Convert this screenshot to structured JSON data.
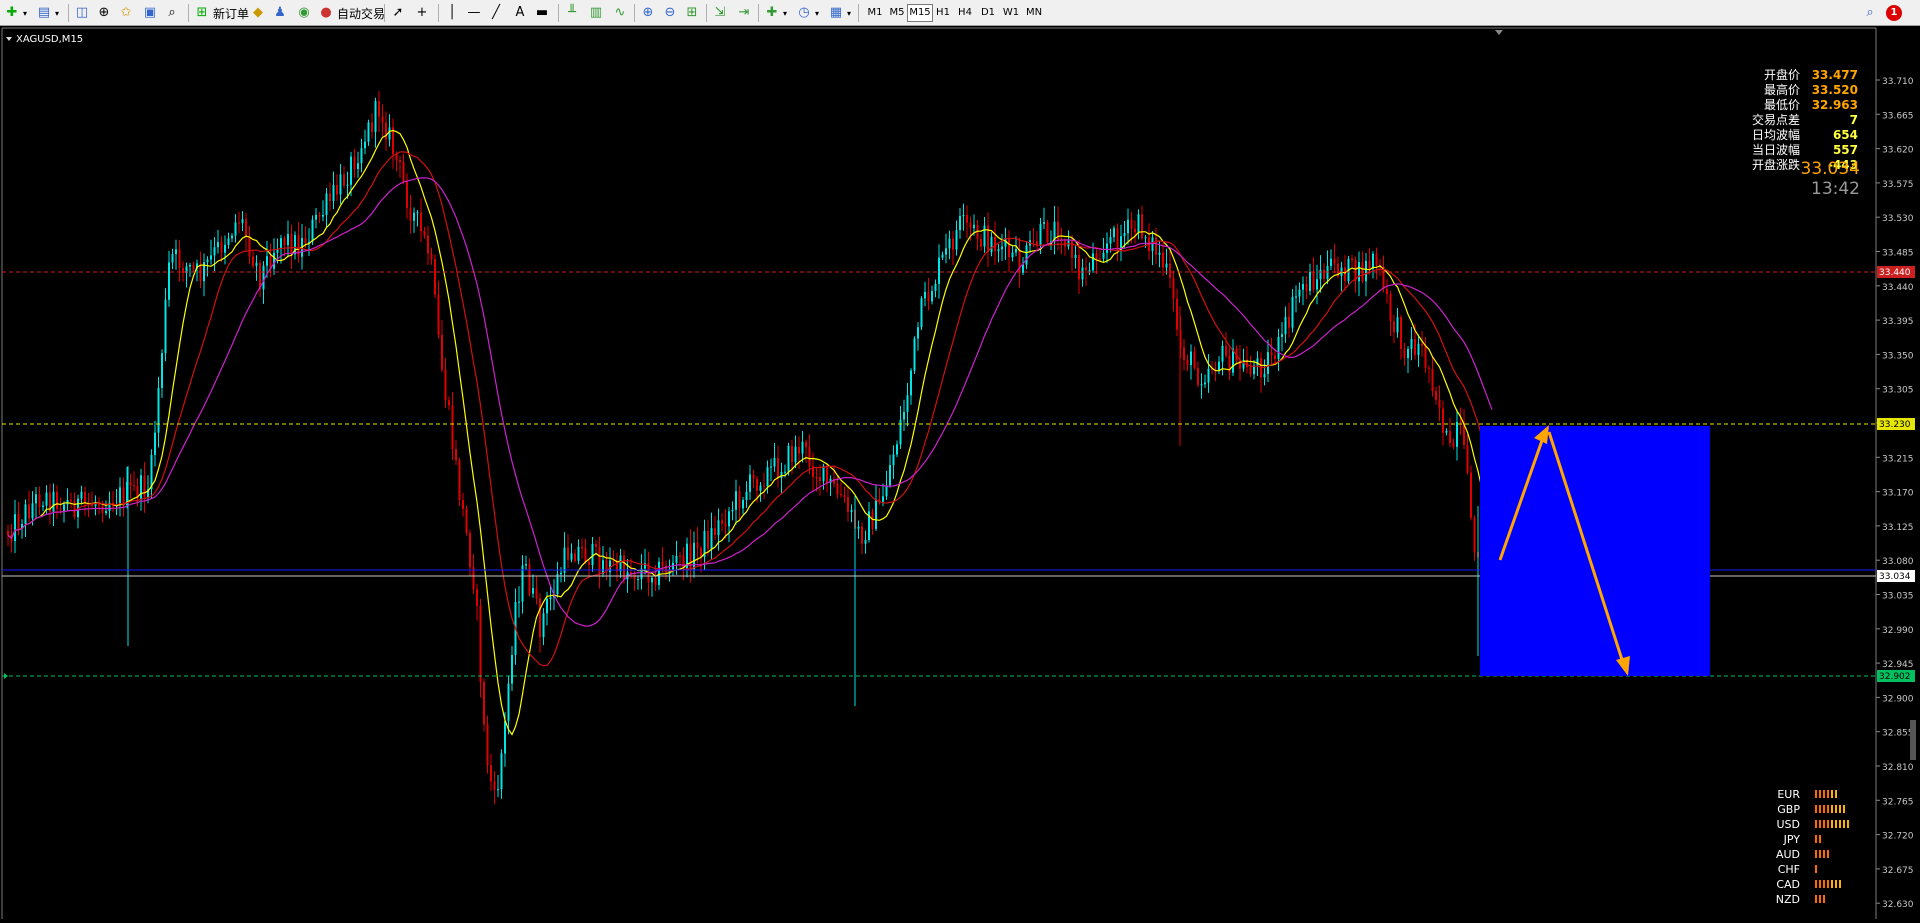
{
  "toolbar": {
    "new_order_label": "新订单",
    "auto_trade_label": "自动交易",
    "timeframes": [
      "M1",
      "M5",
      "M15",
      "H1",
      "H4",
      "D1",
      "W1",
      "MN"
    ],
    "active_timeframe": "M15",
    "notification_count": "1"
  },
  "chart": {
    "symbol_label": "XAGUSD,M15",
    "current_price": "33.034",
    "countdown": "13:42",
    "info_panel": [
      {
        "label": "开盘价",
        "value": "33.477"
      },
      {
        "label": "最高价",
        "value": "33.520"
      },
      {
        "label": "最低价",
        "value": "32.963"
      },
      {
        "label": "交易点差",
        "value": "7"
      },
      {
        "label": "日均波幅",
        "value": "654"
      },
      {
        "label": "当日波幅",
        "value": "557"
      },
      {
        "label": "开盘涨跌",
        "value": "-443"
      }
    ],
    "currency_strength": [
      {
        "label": "EUR",
        "level": 6
      },
      {
        "label": "GBP",
        "level": 8
      },
      {
        "label": "USD",
        "level": 9
      },
      {
        "label": "JPY",
        "level": 2
      },
      {
        "label": "AUD",
        "level": 4
      },
      {
        "label": "CHF",
        "level": 1
      },
      {
        "label": "CAD",
        "level": 7
      },
      {
        "label": "NZD",
        "level": 3
      }
    ],
    "price_axis": [
      "33.710",
      "33.665",
      "33.620",
      "33.575",
      "33.530",
      "33.485",
      "33.440",
      "33.395",
      "33.350",
      "33.305",
      "33.260",
      "33.215",
      "33.170",
      "33.125",
      "33.080",
      "33.035",
      "32.990",
      "32.945",
      "32.900",
      "32.855",
      "32.810",
      "32.765",
      "32.720",
      "32.675",
      "32.630"
    ],
    "level_labels": {
      "red_level": "33.440",
      "yellow_level": "33.230",
      "price_level": "33.034",
      "green_level": "32.902"
    },
    "colors": {
      "bull": "#00e5e5",
      "bear": "#e00000",
      "ma_fast": "#ffff00",
      "ma_mid": "#d01010",
      "ma_slow": "#cc22cc",
      "box": "#0000ff",
      "arrow": "#ffa500"
    }
  }
}
